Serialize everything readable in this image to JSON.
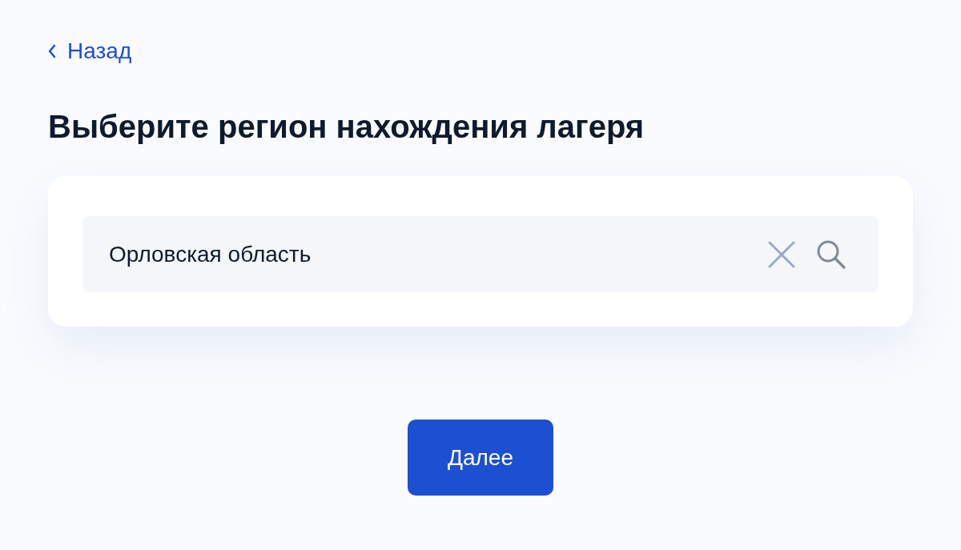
{
  "back_link": {
    "label": "Назад"
  },
  "title": "Выберите регион нахождения лагеря",
  "search": {
    "value": "Орловская область"
  },
  "next_button": {
    "label": "Далее"
  }
}
